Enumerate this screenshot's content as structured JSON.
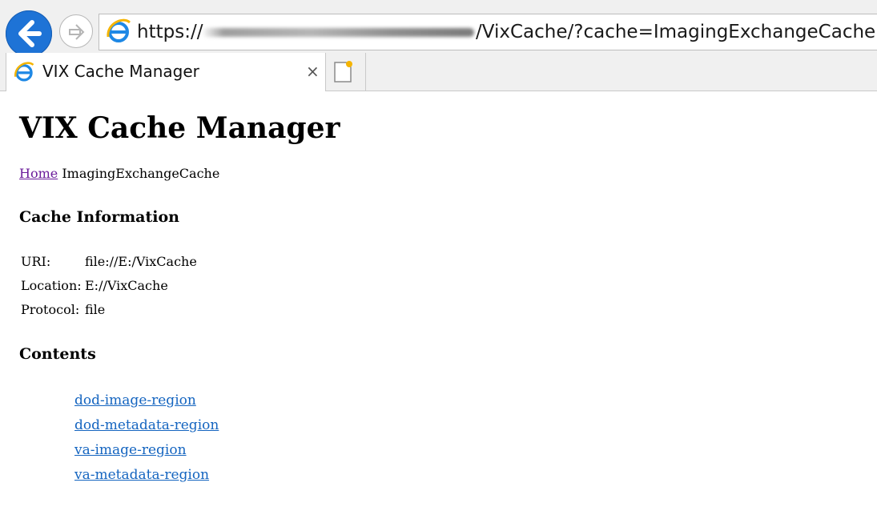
{
  "browser": {
    "address": {
      "scheme": "https://",
      "path": "/VixCache/?cache=ImagingExchangeCache"
    },
    "tabs": [
      {
        "title": "VIX Cache Manager",
        "close": "×"
      }
    ]
  },
  "page": {
    "title": "VIX Cache Manager",
    "breadcrumb": {
      "home": "Home",
      "current": "ImagingExchangeCache"
    },
    "cache_info_heading": "Cache Information",
    "cache_info": [
      {
        "key": "URI:",
        "value": "file://E:/VixCache"
      },
      {
        "key": "Location:",
        "value": "E://VixCache"
      },
      {
        "key": "Protocol:",
        "value": "file"
      }
    ],
    "contents_heading": "Contents",
    "regions": [
      "dod-image-region",
      "dod-metadata-region",
      "va-image-region",
      "va-metadata-region"
    ]
  },
  "colors": {
    "back_button": "#1e73d6",
    "link": "#1565c0",
    "visited_link": "#6a1b9a"
  }
}
